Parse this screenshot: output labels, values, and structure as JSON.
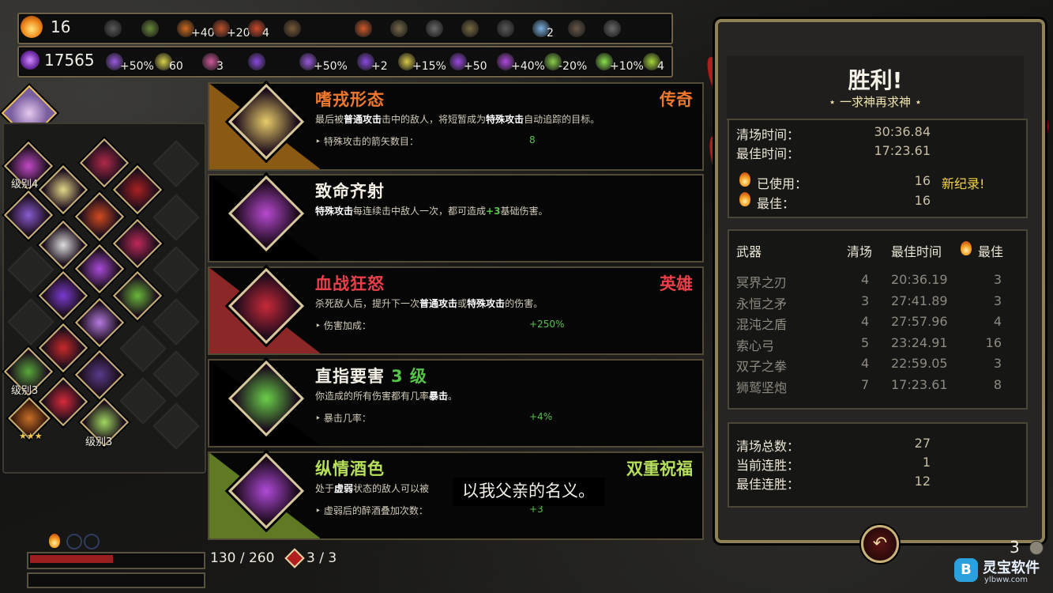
{
  "topbar": {
    "darkness_icon": "flame-skull-icon",
    "count": "16",
    "keepsake_slots": [
      {
        "icon": "dumbbell-icon",
        "text": ""
      },
      {
        "icon": "heart-charm-icon",
        "text": ""
      },
      {
        "icon": "skull-orb-icon",
        "text": "+40%"
      },
      {
        "icon": "mask-icon",
        "text": "+20%"
      },
      {
        "icon": "demon-skull-icon",
        "text": "4"
      },
      {
        "icon": "heart-icon",
        "text": ""
      },
      {
        "icon": "flame-skull-icon",
        "text": ""
      },
      {
        "icon": "boot-icon",
        "text": ""
      },
      {
        "icon": "wrench-icon",
        "text": ""
      },
      {
        "icon": "lock-icon",
        "text": ""
      },
      {
        "icon": "globe-icon",
        "text": ""
      },
      {
        "icon": "heart-gem-icon",
        "text": "2"
      },
      {
        "icon": "bucket-icon",
        "text": ""
      },
      {
        "icon": "hammer-icon",
        "text": ""
      }
    ]
  },
  "resources": {
    "gems": "17565",
    "items": [
      {
        "icon": "purple-glyph-icon",
        "text": "+50%"
      },
      {
        "icon": "gold-leaf-icon",
        "text": "60"
      },
      {
        "icon": "portrait-icon",
        "text": "3"
      },
      {
        "icon": "arrow-icon",
        "text": ""
      },
      {
        "icon": "purple-star-icon",
        "text": "+50%"
      },
      {
        "icon": "crystal-icon",
        "text": "+2"
      },
      {
        "icon": "gold-coins-icon",
        "text": "+15%"
      },
      {
        "icon": "purple-heart-icon",
        "text": "+50"
      },
      {
        "icon": "purple-burst-icon",
        "text": "+40%"
      },
      {
        "icon": "green-orb-icon",
        "text": "-20%"
      },
      {
        "icon": "green-splash-icon",
        "text": "+10%"
      },
      {
        "icon": "green-pyramid-icon",
        "text": "4"
      }
    ]
  },
  "traits": {
    "level_labels": [
      "级别4",
      "级别3",
      "级别3"
    ],
    "stars": "★★★"
  },
  "boons": [
    {
      "name": "嗜戎形态",
      "rarity": "传奇",
      "rarity_color": "#f0782c",
      "name_color": "#f0782c",
      "desc_parts": [
        "最后被",
        "普通攻击",
        "击中的敌人，将短暂成为",
        "特殊攻击",
        "自动追踪的目标。"
      ],
      "stat_label": "‣ 特殊攻击的箭矢数目：",
      "stat_value": "8",
      "accent": "#8a5a14",
      "icon": "golden-bow-icon"
    },
    {
      "name": "致命齐射",
      "rarity": "",
      "rarity_color": "#ffffff",
      "name_color": "#f3efe4",
      "desc_parts": [
        "",
        "特殊攻击",
        "每连续击中敌人一次，都可造成",
        "+3",
        "基础伤害。"
      ],
      "stat_label": "",
      "stat_value": "",
      "accent": "#000000",
      "icon": "purple-arrows-icon"
    },
    {
      "name": "血战狂怒",
      "rarity": "英雄",
      "rarity_color": "#e9404a",
      "name_color": "#e9404a",
      "desc_parts": [
        "杀死敌人后，提升下一次",
        "普通攻击",
        "或",
        "特殊攻击",
        "的伤害。"
      ],
      "stat_label": "‣ 伤害加成：",
      "stat_value": "+250%",
      "accent": "#8c2727",
      "icon": "red-fist-icon"
    },
    {
      "name": "直指要害",
      "level": "3 级",
      "rarity": "",
      "rarity_color": "#ffffff",
      "name_color": "#f3efe4",
      "desc_parts": [
        "你造成的所有伤害都有几率",
        "暴击",
        "。"
      ],
      "stat_label": "‣ 暴击几率：",
      "stat_value": "+4%",
      "accent": "#000000",
      "icon": "green-crit-icon"
    },
    {
      "name": "纵情酒色",
      "rarity": "双重祝福",
      "rarity_color": "#b7e05a",
      "name_color": "#b7e05a",
      "desc_parts": [
        "处于",
        "虚弱",
        "状态的敌人可以被",
        "",
        ""
      ],
      "stat_label": "‣ 虚弱后的醉酒叠加次数：",
      "stat_value": "+3",
      "accent": "#607a24",
      "icon": "purple-heart-wine-icon"
    }
  ],
  "subtitle": "以我父亲的名义。",
  "bottom": {
    "hp": "130 / 260",
    "hp_fraction": 0.5,
    "casts": "3 / 3",
    "count_right": "3"
  },
  "results": {
    "title": "胜利!",
    "subtitle": "⋆ 一求神再求神 ⋆",
    "clear_time_label": "清场时间：",
    "clear_time": "30:36.84",
    "best_time_label": "最佳时间：",
    "best_time": "17:23.61",
    "used_label": "已使用：",
    "used": "16",
    "new_record": "新纪录!",
    "best_label": "最佳：",
    "best": "16",
    "table_headers": [
      "武器",
      "清场",
      "最佳时间",
      "最佳"
    ],
    "weapons": [
      {
        "name": "冥界之刃",
        "clears": "4",
        "time": "20:36.19",
        "best": "3"
      },
      {
        "name": "永恒之矛",
        "clears": "3",
        "time": "27:41.89",
        "best": "3"
      },
      {
        "name": "混沌之盾",
        "clears": "4",
        "time": "27:57.96",
        "best": "4"
      },
      {
        "name": "索心弓",
        "clears": "5",
        "time": "23:24.91",
        "best": "16"
      },
      {
        "name": "双子之拳",
        "clears": "4",
        "time": "22:59.05",
        "best": "3"
      },
      {
        "name": "狮鹫坚炮",
        "clears": "7",
        "time": "17:23.61",
        "best": "8"
      }
    ],
    "total_clears_label": "清场总数：",
    "total_clears": "27",
    "streak_label": "当前连胜：",
    "streak": "1",
    "best_streak_label": "最佳连胜：",
    "best_streak": "12",
    "back_icon": "back-arrow-icon"
  },
  "watermark": {
    "name": "灵宝软件",
    "url": "ylbww.com"
  }
}
